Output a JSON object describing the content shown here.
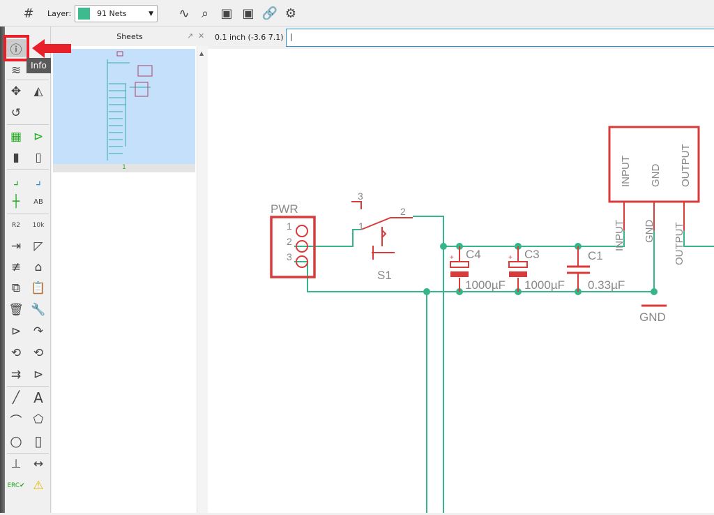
{
  "toolbar": {
    "grid_icon": "grid-icon",
    "layer_label": "Layer:",
    "layer_value": "91 Nets",
    "layer_color": "#3dbb8f",
    "icons": [
      "wave-icon",
      "zoom-wave-icon",
      "meter-icon",
      "meter2-icon",
      "link-add-icon",
      "gear-icon"
    ]
  },
  "sheets": {
    "title": "Sheets",
    "page_number": "1"
  },
  "command": {
    "grid_readout": "0.1 inch (-3.6 7.1)",
    "input_value": "|"
  },
  "tooltip": {
    "text": "Info"
  },
  "schematic": {
    "pwr": {
      "name": "PWR",
      "pins": [
        "1",
        "2",
        "3"
      ]
    },
    "switch": {
      "name": "S1",
      "pins": [
        "1",
        "2",
        "3"
      ]
    },
    "caps": [
      {
        "name": "C4",
        "value": "1000µF"
      },
      {
        "name": "C3",
        "value": "1000µF"
      },
      {
        "name": "C1",
        "value": "0.33µF"
      }
    ],
    "regulator": {
      "pins": [
        "INPUT",
        "GND",
        "OUTPUT"
      ]
    },
    "gnd": "GND",
    "plus": "+",
    "wire_color": "#36b58a",
    "part_color": "#d93a3a"
  }
}
